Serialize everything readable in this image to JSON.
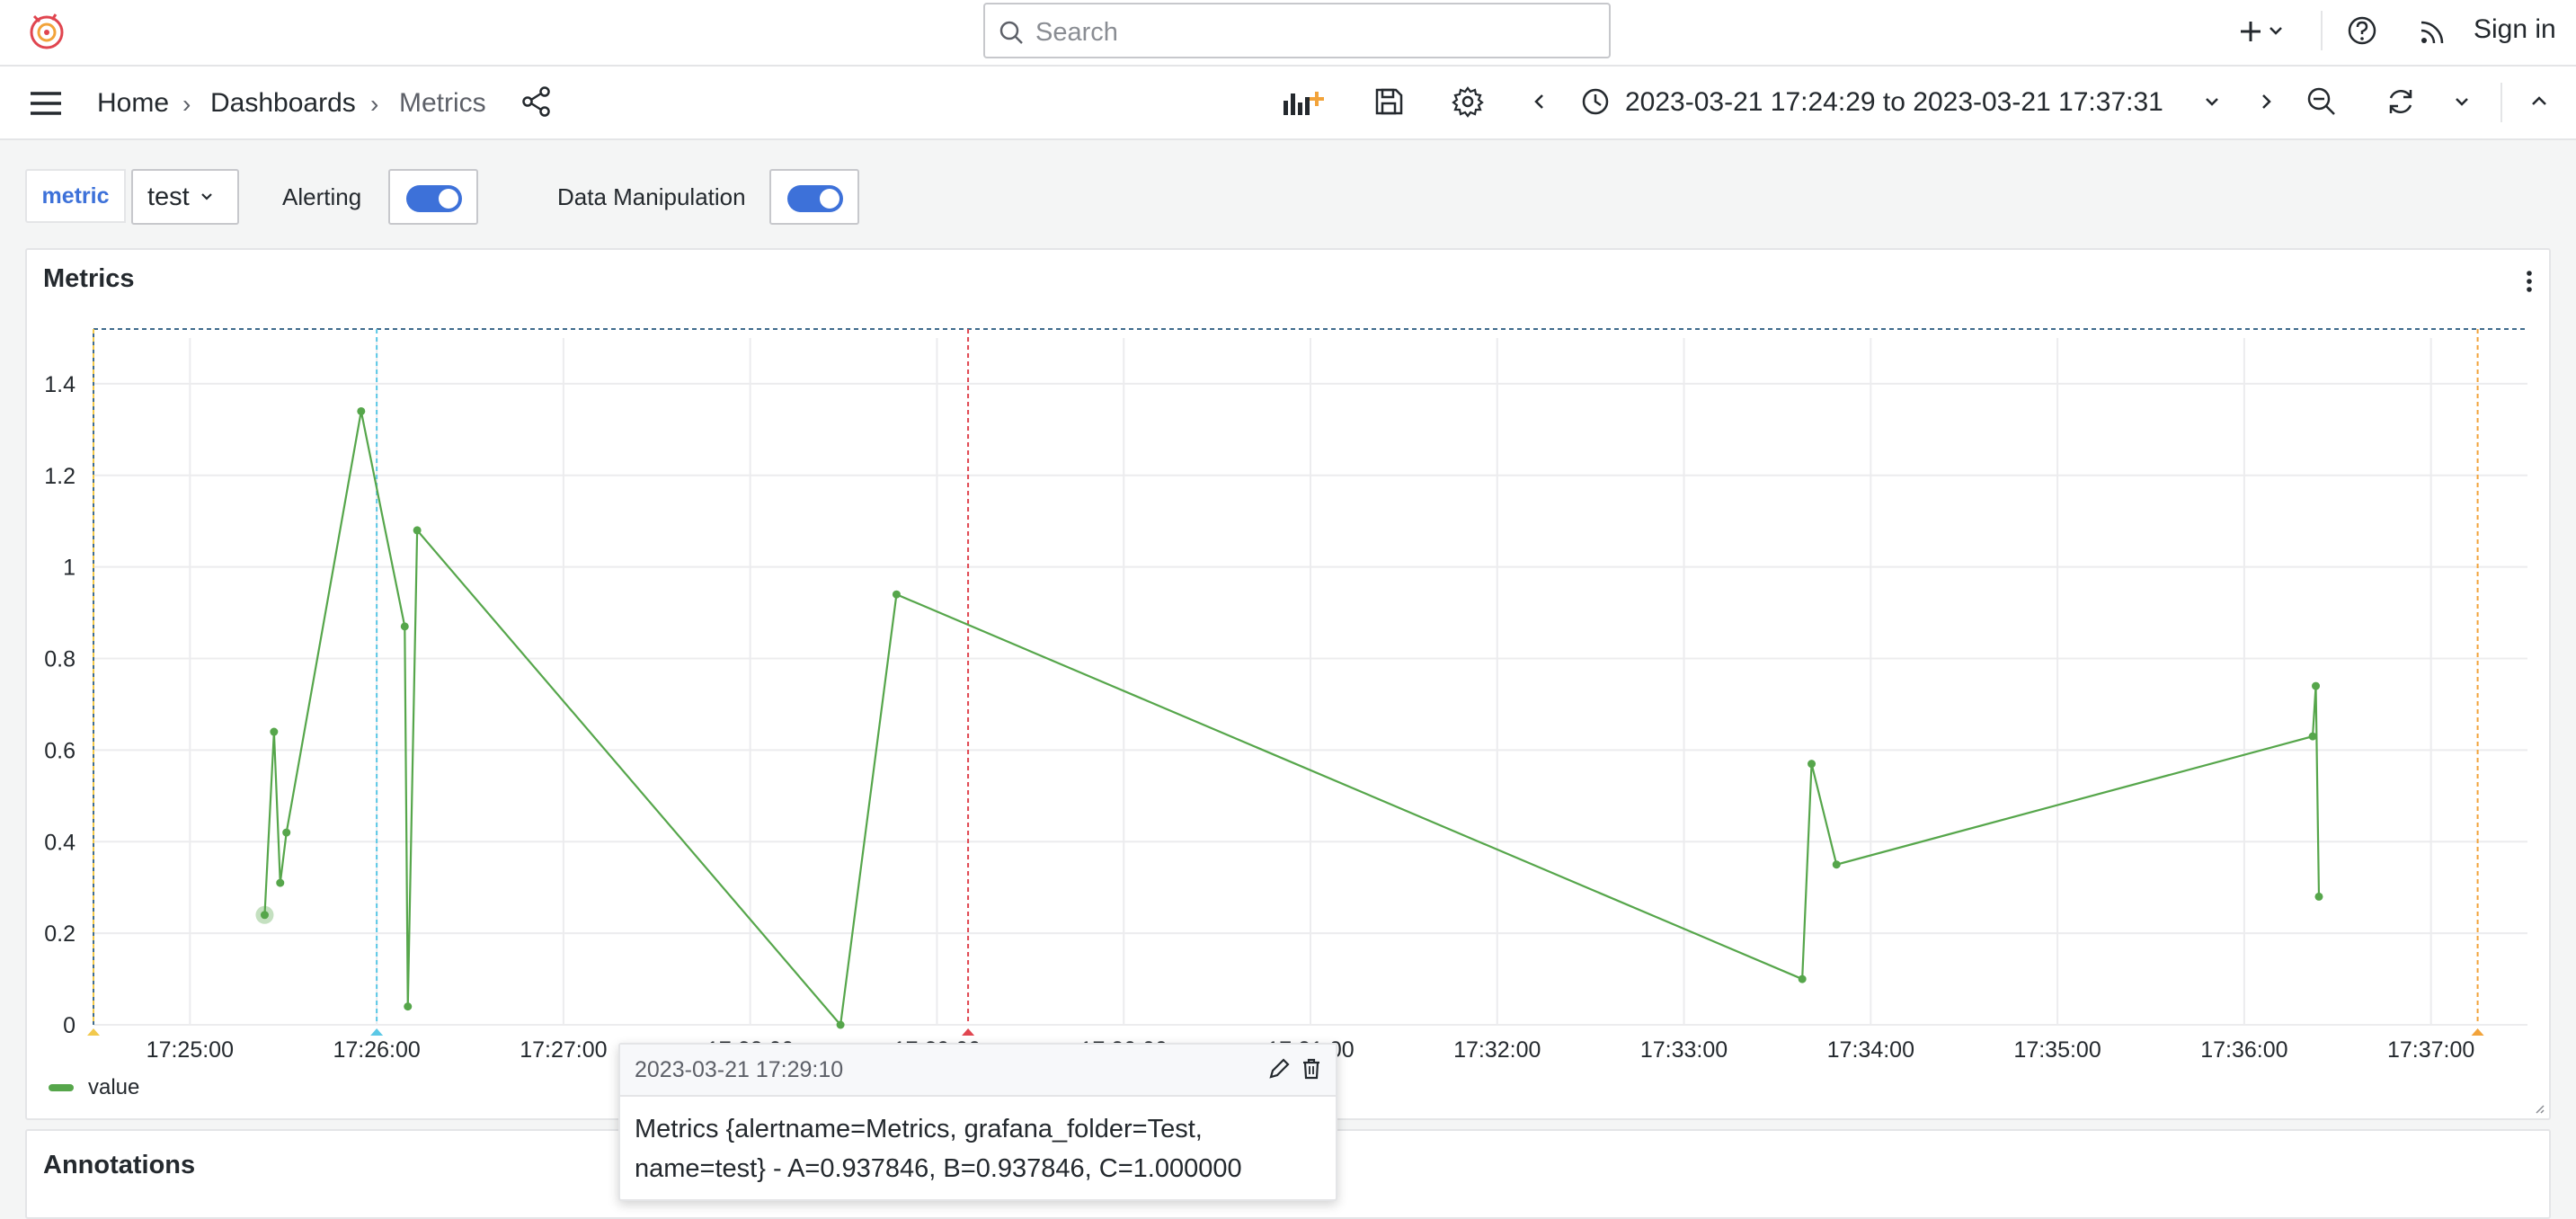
{
  "topbar": {
    "search_placeholder": "Search",
    "sign_in": "Sign in"
  },
  "breadcrumb": {
    "home": "Home",
    "dashboards": "Dashboards",
    "current": "Metrics"
  },
  "time_range": "2023-03-21 17:24:29 to 2023-03-21 17:37:31",
  "variables": {
    "metric_label": "metric",
    "metric_value": "test",
    "alerting_label": "Alerting",
    "alerting_on": true,
    "data_manipulation_label": "Data Manipulation",
    "data_manipulation_on": true
  },
  "panel": {
    "title": "Metrics",
    "legend_label": "value"
  },
  "annotations_panel": {
    "title": "Annotations"
  },
  "tooltip": {
    "time": "2023-03-21 17:29:10",
    "text": "Metrics {alertname=Metrics, grafana_folder=Test, name=test} - A=0.937846, B=0.937846, C=1.000000"
  },
  "chart_data": {
    "type": "line",
    "x_unit": "time",
    "xlim": [
      "17:24:29",
      "17:37:31"
    ],
    "ylim": [
      0,
      1.5
    ],
    "y_ticks": [
      "0",
      "0.2",
      "0.4",
      "0.6",
      "0.8",
      "1",
      "1.2",
      "1.4"
    ],
    "x_ticks": [
      "17:25:00",
      "17:26:00",
      "17:27:00",
      "17:28:00",
      "17:29:00",
      "17:30:00",
      "17:31:00",
      "17:32:00",
      "17:33:00",
      "17:34:00",
      "17:35:00",
      "17:36:00",
      "17:37:00"
    ],
    "grid": true,
    "legend_position": "bottom-left",
    "series": [
      {
        "name": "value",
        "color": "#56a64b",
        "x": [
          "17:25:24",
          "17:25:27",
          "17:25:29",
          "17:25:31",
          "17:25:55",
          "17:26:09",
          "17:26:10",
          "17:26:13",
          "17:28:29",
          "17:28:47",
          "17:33:38",
          "17:33:41",
          "17:33:49",
          "17:36:22",
          "17:36:23",
          "17:36:24"
        ],
        "y": [
          0.24,
          0.64,
          0.31,
          0.42,
          1.34,
          0.87,
          0.04,
          1.08,
          0.0,
          0.94,
          0.1,
          0.57,
          0.35,
          0.63,
          0.74,
          0.28
        ]
      }
    ],
    "annotations": [
      {
        "time": "17:24:29",
        "color": "#f2c94c"
      },
      {
        "time": "17:26:00",
        "color": "#5bc8e6"
      },
      {
        "time": "17:29:10",
        "color": "#e0454f"
      },
      {
        "time": "17:37:15",
        "color": "#f2a33a"
      }
    ]
  },
  "colors": {
    "accent": "#3d71d9",
    "series": "#56a64b"
  }
}
